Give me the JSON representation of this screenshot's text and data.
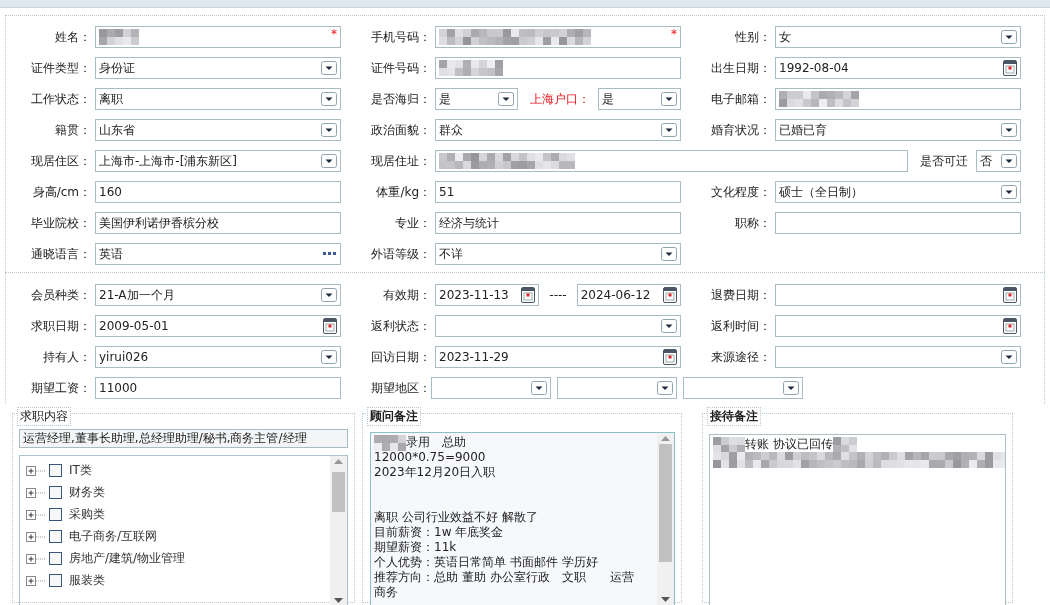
{
  "section_1": {
    "rows": [
      {
        "kind": "standard",
        "cells": [
          {
            "label": "姓名：",
            "controls": [
              {
                "kind": "text",
                "redacted": true,
                "required_mark": "*"
              }
            ]
          },
          {
            "label": "手机号码：",
            "controls": [
              {
                "kind": "text",
                "redacted": true,
                "required_mark": "*"
              }
            ]
          },
          {
            "label": "性别：",
            "controls": [
              {
                "kind": "select",
                "value": "女"
              }
            ]
          }
        ]
      },
      {
        "kind": "standard",
        "cells": [
          {
            "label": "证件类型：",
            "controls": [
              {
                "kind": "select",
                "value": "身份证"
              }
            ]
          },
          {
            "label": "证件号码：",
            "controls": [
              {
                "kind": "text",
                "redacted": true
              }
            ]
          },
          {
            "label": "出生日期：",
            "controls": [
              {
                "kind": "date",
                "value": "1992-08-04"
              }
            ]
          }
        ]
      },
      {
        "kind": "standard",
        "cells": [
          {
            "label": "工作状态：",
            "controls": [
              {
                "kind": "select",
                "value": "离职"
              }
            ]
          },
          {
            "label": "是否海归：",
            "controls": [
              {
                "kind": "select",
                "value": "是"
              },
              {
                "kind": "inline_label",
                "text": "上海户口：",
                "highlighted": true
              },
              {
                "kind": "select",
                "value": "是"
              }
            ]
          },
          {
            "label": "电子邮箱：",
            "controls": [
              {
                "kind": "text",
                "redacted": true
              }
            ]
          }
        ]
      },
      {
        "kind": "standard",
        "cells": [
          {
            "label": "籍贯：",
            "controls": [
              {
                "kind": "select",
                "value": "山东省"
              }
            ]
          },
          {
            "label": "政治面貌：",
            "controls": [
              {
                "kind": "select",
                "value": "群众"
              }
            ]
          },
          {
            "label": "婚育状况：",
            "controls": [
              {
                "kind": "select",
                "value": "已婚已育"
              }
            ]
          }
        ]
      },
      {
        "kind": "address",
        "cells": [
          {
            "label": "现居住区：",
            "controls": [
              {
                "kind": "select",
                "value": "上海市-上海市-[浦东新区]"
              }
            ]
          },
          {
            "label": "现居住址：",
            "controls": [
              {
                "kind": "text",
                "redacted": true
              },
              {
                "kind": "inline_label",
                "text": "是否可迁",
                "highlighted": false
              },
              {
                "kind": "select",
                "value": "否"
              }
            ]
          }
        ]
      },
      {
        "kind": "standard",
        "cells": [
          {
            "label": "身高/cm：",
            "controls": [
              {
                "kind": "text",
                "value": "160"
              }
            ]
          },
          {
            "label": "体重/kg：",
            "controls": [
              {
                "kind": "text",
                "value": "51"
              }
            ]
          },
          {
            "label": "文化程度：",
            "controls": [
              {
                "kind": "select",
                "value": "硕士（全日制）"
              }
            ]
          }
        ]
      },
      {
        "kind": "standard",
        "cells": [
          {
            "label": "毕业院校：",
            "controls": [
              {
                "kind": "text",
                "value": "美国伊利诺伊香槟分校"
              }
            ]
          },
          {
            "label": "专业：",
            "controls": [
              {
                "kind": "text",
                "value": "经济与统计"
              }
            ]
          },
          {
            "label": "职称：",
            "controls": [
              {
                "kind": "text"
              }
            ]
          }
        ]
      },
      {
        "kind": "standard",
        "cells": [
          {
            "label": "通晓语言：",
            "controls": [
              {
                "kind": "picker",
                "value": "英语"
              }
            ]
          },
          {
            "label": "外语等级：",
            "controls": [
              {
                "kind": "select",
                "value": "不详"
              }
            ]
          }
        ]
      }
    ]
  },
  "section_2": {
    "rows": [
      {
        "kind": "standard",
        "cells": [
          {
            "label": "会员种类：",
            "controls": [
              {
                "kind": "select",
                "value": "21-A加一个月"
              }
            ]
          },
          {
            "label": "有效期：",
            "controls": [
              {
                "kind": "date",
                "value": "2023-11-13"
              },
              {
                "kind": "dash",
                "text": "----"
              },
              {
                "kind": "date",
                "value": "2024-06-12"
              }
            ]
          },
          {
            "label": "退费日期：",
            "controls": [
              {
                "kind": "date"
              }
            ]
          }
        ]
      },
      {
        "kind": "standard",
        "cells": [
          {
            "label": "求职日期：",
            "controls": [
              {
                "kind": "date",
                "value": "2009-05-01"
              }
            ]
          },
          {
            "label": "返利状态：",
            "controls": [
              {
                "kind": "select"
              }
            ]
          },
          {
            "label": "返利时间：",
            "controls": [
              {
                "kind": "date"
              }
            ]
          }
        ]
      },
      {
        "kind": "standard",
        "cells": [
          {
            "label": "持有人：",
            "controls": [
              {
                "kind": "select",
                "value": "yirui026"
              }
            ]
          },
          {
            "label": "回访日期：",
            "controls": [
              {
                "kind": "date",
                "value": "2023-11-29"
              }
            ]
          },
          {
            "label": "来源途径：",
            "controls": [
              {
                "kind": "select"
              }
            ]
          }
        ]
      },
      {
        "kind": "region",
        "cells": [
          {
            "label": "期望工资：",
            "controls": [
              {
                "kind": "text",
                "value": "11000"
              }
            ]
          },
          {
            "label": "期望地区：",
            "controls": [
              {
                "kind": "select"
              },
              {
                "kind": "select"
              },
              {
                "kind": "select"
              }
            ]
          }
        ]
      }
    ]
  },
  "job_content": {
    "legend": "求职内容",
    "summary": "运营经理,董事长助理,总经理助理/秘书,商务主管/经理",
    "tree": [
      {
        "label": "IT类",
        "expanded": false,
        "checked": false
      },
      {
        "label": "财务类",
        "expanded": false,
        "checked": false
      },
      {
        "label": "采购类",
        "expanded": false,
        "checked": false
      },
      {
        "label": "电子商务/互联网",
        "expanded": false,
        "checked": false
      },
      {
        "label": "房地产/建筑/物业管理",
        "expanded": false,
        "checked": false
      },
      {
        "label": "服装类",
        "expanded": false,
        "checked": false
      }
    ]
  },
  "consultant_notes": {
    "legend": "顾问备注",
    "lines": [
      {
        "kind": "line",
        "text": "录用　总助",
        "redacted_prefix": true,
        "redacted_suffix": false
      },
      {
        "kind": "line",
        "text": "12000*0.75=9000",
        "redacted_prefix": false,
        "redacted_suffix": false
      },
      {
        "kind": "line",
        "text": "2023年12月20日入职",
        "redacted_prefix": false,
        "redacted_suffix": false
      },
      {
        "kind": "blank"
      },
      {
        "kind": "blank"
      },
      {
        "kind": "line",
        "text": "离职 公司行业效益不好 解散了",
        "redacted_prefix": false,
        "redacted_suffix": false
      },
      {
        "kind": "line",
        "text": "目前薪资：1w 年底奖金",
        "redacted_prefix": false,
        "redacted_suffix": false
      },
      {
        "kind": "line",
        "text": "期望薪资：11k",
        "redacted_prefix": false,
        "redacted_suffix": false
      },
      {
        "kind": "line",
        "text": "个人优势：英语日常简单 书面邮件 学历好",
        "redacted_prefix": false,
        "redacted_suffix": false
      },
      {
        "kind": "line",
        "text": "推荐方向：总助 董助 办公室行政　文职　　运营",
        "redacted_prefix": false,
        "redacted_suffix": false
      },
      {
        "kind": "line",
        "text": "商务",
        "redacted_prefix": false,
        "redacted_suffix": false
      }
    ]
  },
  "reception_notes": {
    "legend": "接待备注",
    "lines": [
      {
        "kind": "line",
        "text": "转账 协议已回传",
        "redacted_prefix": true,
        "redacted_suffix": true
      },
      {
        "kind": "redacted_block"
      }
    ]
  }
}
